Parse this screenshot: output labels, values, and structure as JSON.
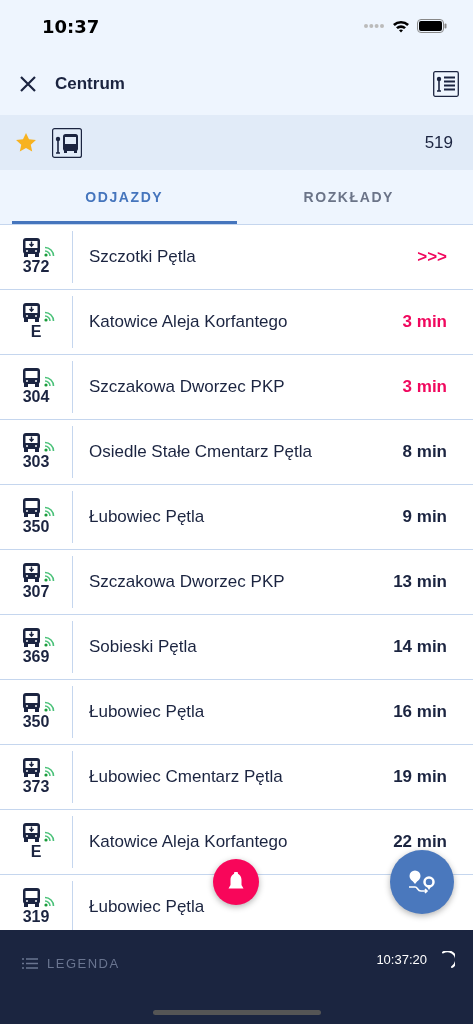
{
  "status_bar": {
    "time": "10:37"
  },
  "header": {
    "title": "Centrum"
  },
  "stop": {
    "favorite": true,
    "number": "519"
  },
  "tabs": [
    {
      "label": "ODJAZDY",
      "selected": true
    },
    {
      "label": "ROZKŁADY",
      "selected": false
    }
  ],
  "departures": [
    {
      "kind": "marked",
      "line": "372",
      "destination": "Szczotki Pętla",
      "time": ">>>",
      "urgent": true
    },
    {
      "kind": "marked",
      "line": "E",
      "destination": "Katowice Aleja Korfantego",
      "time": "3 min",
      "urgent": true
    },
    {
      "kind": "plain",
      "line": "304",
      "destination": "Szczakowa Dworzec PKP",
      "time": "3 min",
      "urgent": true
    },
    {
      "kind": "marked",
      "line": "303",
      "destination": "Osiedle Stałe Cmentarz Pętla",
      "time": "8 min",
      "urgent": false
    },
    {
      "kind": "plain",
      "line": "350",
      "destination": "Łubowiec Pętla",
      "time": "9 min",
      "urgent": false
    },
    {
      "kind": "marked",
      "line": "307",
      "destination": "Szczakowa Dworzec PKP",
      "time": "13 min",
      "urgent": false
    },
    {
      "kind": "marked",
      "line": "369",
      "destination": "Sobieski Pętla",
      "time": "14 min",
      "urgent": false
    },
    {
      "kind": "plain",
      "line": "350",
      "destination": "Łubowiec Pętla",
      "time": "16 min",
      "urgent": false
    },
    {
      "kind": "marked",
      "line": "373",
      "destination": "Łubowiec Cmentarz Pętla",
      "time": "19 min",
      "urgent": false
    },
    {
      "kind": "marked",
      "line": "E",
      "destination": "Katowice Aleja Korfantego",
      "time": "22 min",
      "urgent": false
    },
    {
      "kind": "plain",
      "line": "319",
      "destination": "Łubowiec Pętla"
    }
  ],
  "footer": {
    "legend": "LEGENDA",
    "updated": "10:37:20"
  }
}
